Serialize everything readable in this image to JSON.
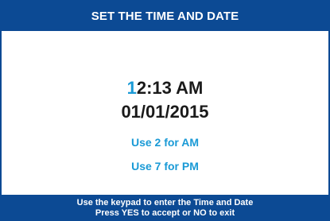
{
  "header": {
    "title": "SET THE TIME AND DATE"
  },
  "display": {
    "time_cursor_digit": "1",
    "time_rest": "2:13 AM",
    "date": "01/01/2015",
    "hint_am": "Use 2 for AM",
    "hint_pm": "Use 7 for PM"
  },
  "footer": {
    "line1": "Use the keypad to enter the Time and Date",
    "line2": "Press YES to accept or NO to exit"
  },
  "colors": {
    "bar": "#0c4a94",
    "accent": "#1a9ad6",
    "text": "#1a1a1a"
  }
}
